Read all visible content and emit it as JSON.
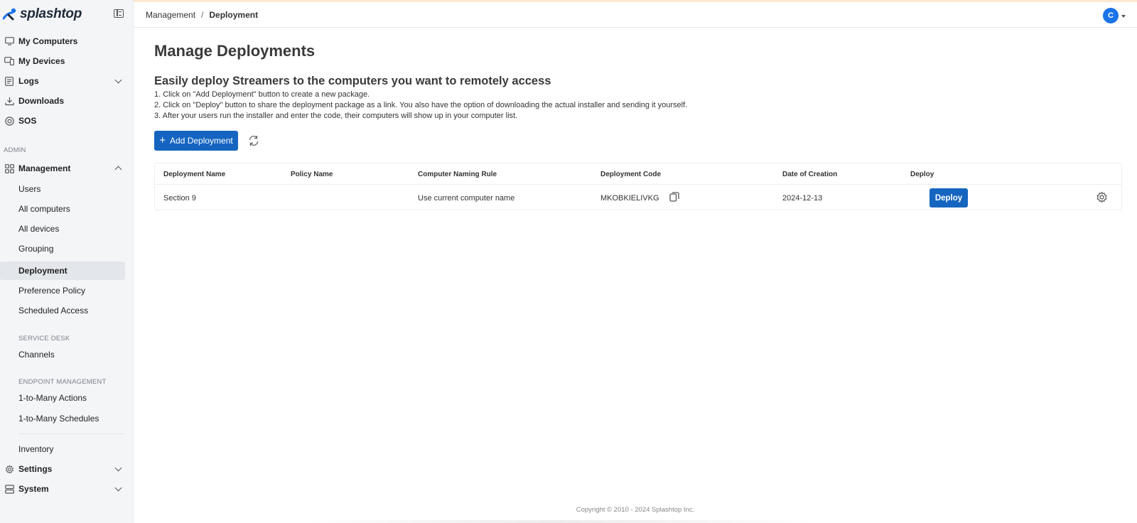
{
  "app": {
    "logo_text": "splashtop"
  },
  "sidebar": {
    "primary": [
      {
        "label": "My Computers",
        "icon": "monitor-icon"
      },
      {
        "label": "My Devices",
        "icon": "devices-icon"
      },
      {
        "label": "Logs",
        "icon": "logs-icon"
      },
      {
        "label": "Downloads",
        "icon": "download-icon"
      },
      {
        "label": "SOS",
        "icon": "sos-icon"
      }
    ],
    "admin_label": "ADMIN",
    "management_label": "Management",
    "management_items": [
      {
        "label": "Users"
      },
      {
        "label": "All computers"
      },
      {
        "label": "All devices"
      },
      {
        "label": "Grouping"
      },
      {
        "label": "Deployment",
        "active": true
      },
      {
        "label": "Preference Policy"
      },
      {
        "label": "Scheduled Access"
      }
    ],
    "service_desk_label": "SERVICE DESK",
    "service_desk_items": [
      {
        "label": "Channels"
      }
    ],
    "endpoint_label": "ENDPOINT MANAGEMENT",
    "endpoint_items": [
      {
        "label": "1-to-Many Actions"
      },
      {
        "label": "1-to-Many Schedules"
      }
    ],
    "inventory_label": "Inventory",
    "settings_label": "Settings",
    "system_label": "System"
  },
  "header": {
    "breadcrumb": [
      "Management",
      "Deployment"
    ],
    "breadcrumb_sep": "/",
    "avatar_initial": "C"
  },
  "main": {
    "title": "Manage Deployments",
    "subtitle": "Easily deploy Streamers to the computers you want to remotely access",
    "steps": [
      "1. Click on \"Add Deployment\" button to create a new package.",
      "2. Click on \"Deploy\" button to share the deployment package as a link. You also have the option of downloading the actual installer and sending it yourself.",
      "3. After your users run the installer and enter the code, their computers will show up in your computer list."
    ],
    "add_button": "Add Deployment",
    "table": {
      "columns": [
        "Deployment Name",
        "Policy Name",
        "Computer Naming Rule",
        "Deployment Code",
        "Date of Creation",
        "Deploy"
      ],
      "rows": [
        {
          "name": "Section 9",
          "policy": "",
          "naming_rule": "Use current computer name",
          "code": "MKOBKIELIVKG",
          "date": "2024-12-13",
          "deploy_label": "Deploy"
        }
      ]
    }
  },
  "footer": {
    "copyright": "Copyright © 2010 - 2024 Splashtop Inc."
  },
  "colors": {
    "primary": "#1565c0",
    "avatar": "#1a73e8",
    "sidebar_bg": "#f4f5f7",
    "active_bg": "#e3e6ea"
  }
}
